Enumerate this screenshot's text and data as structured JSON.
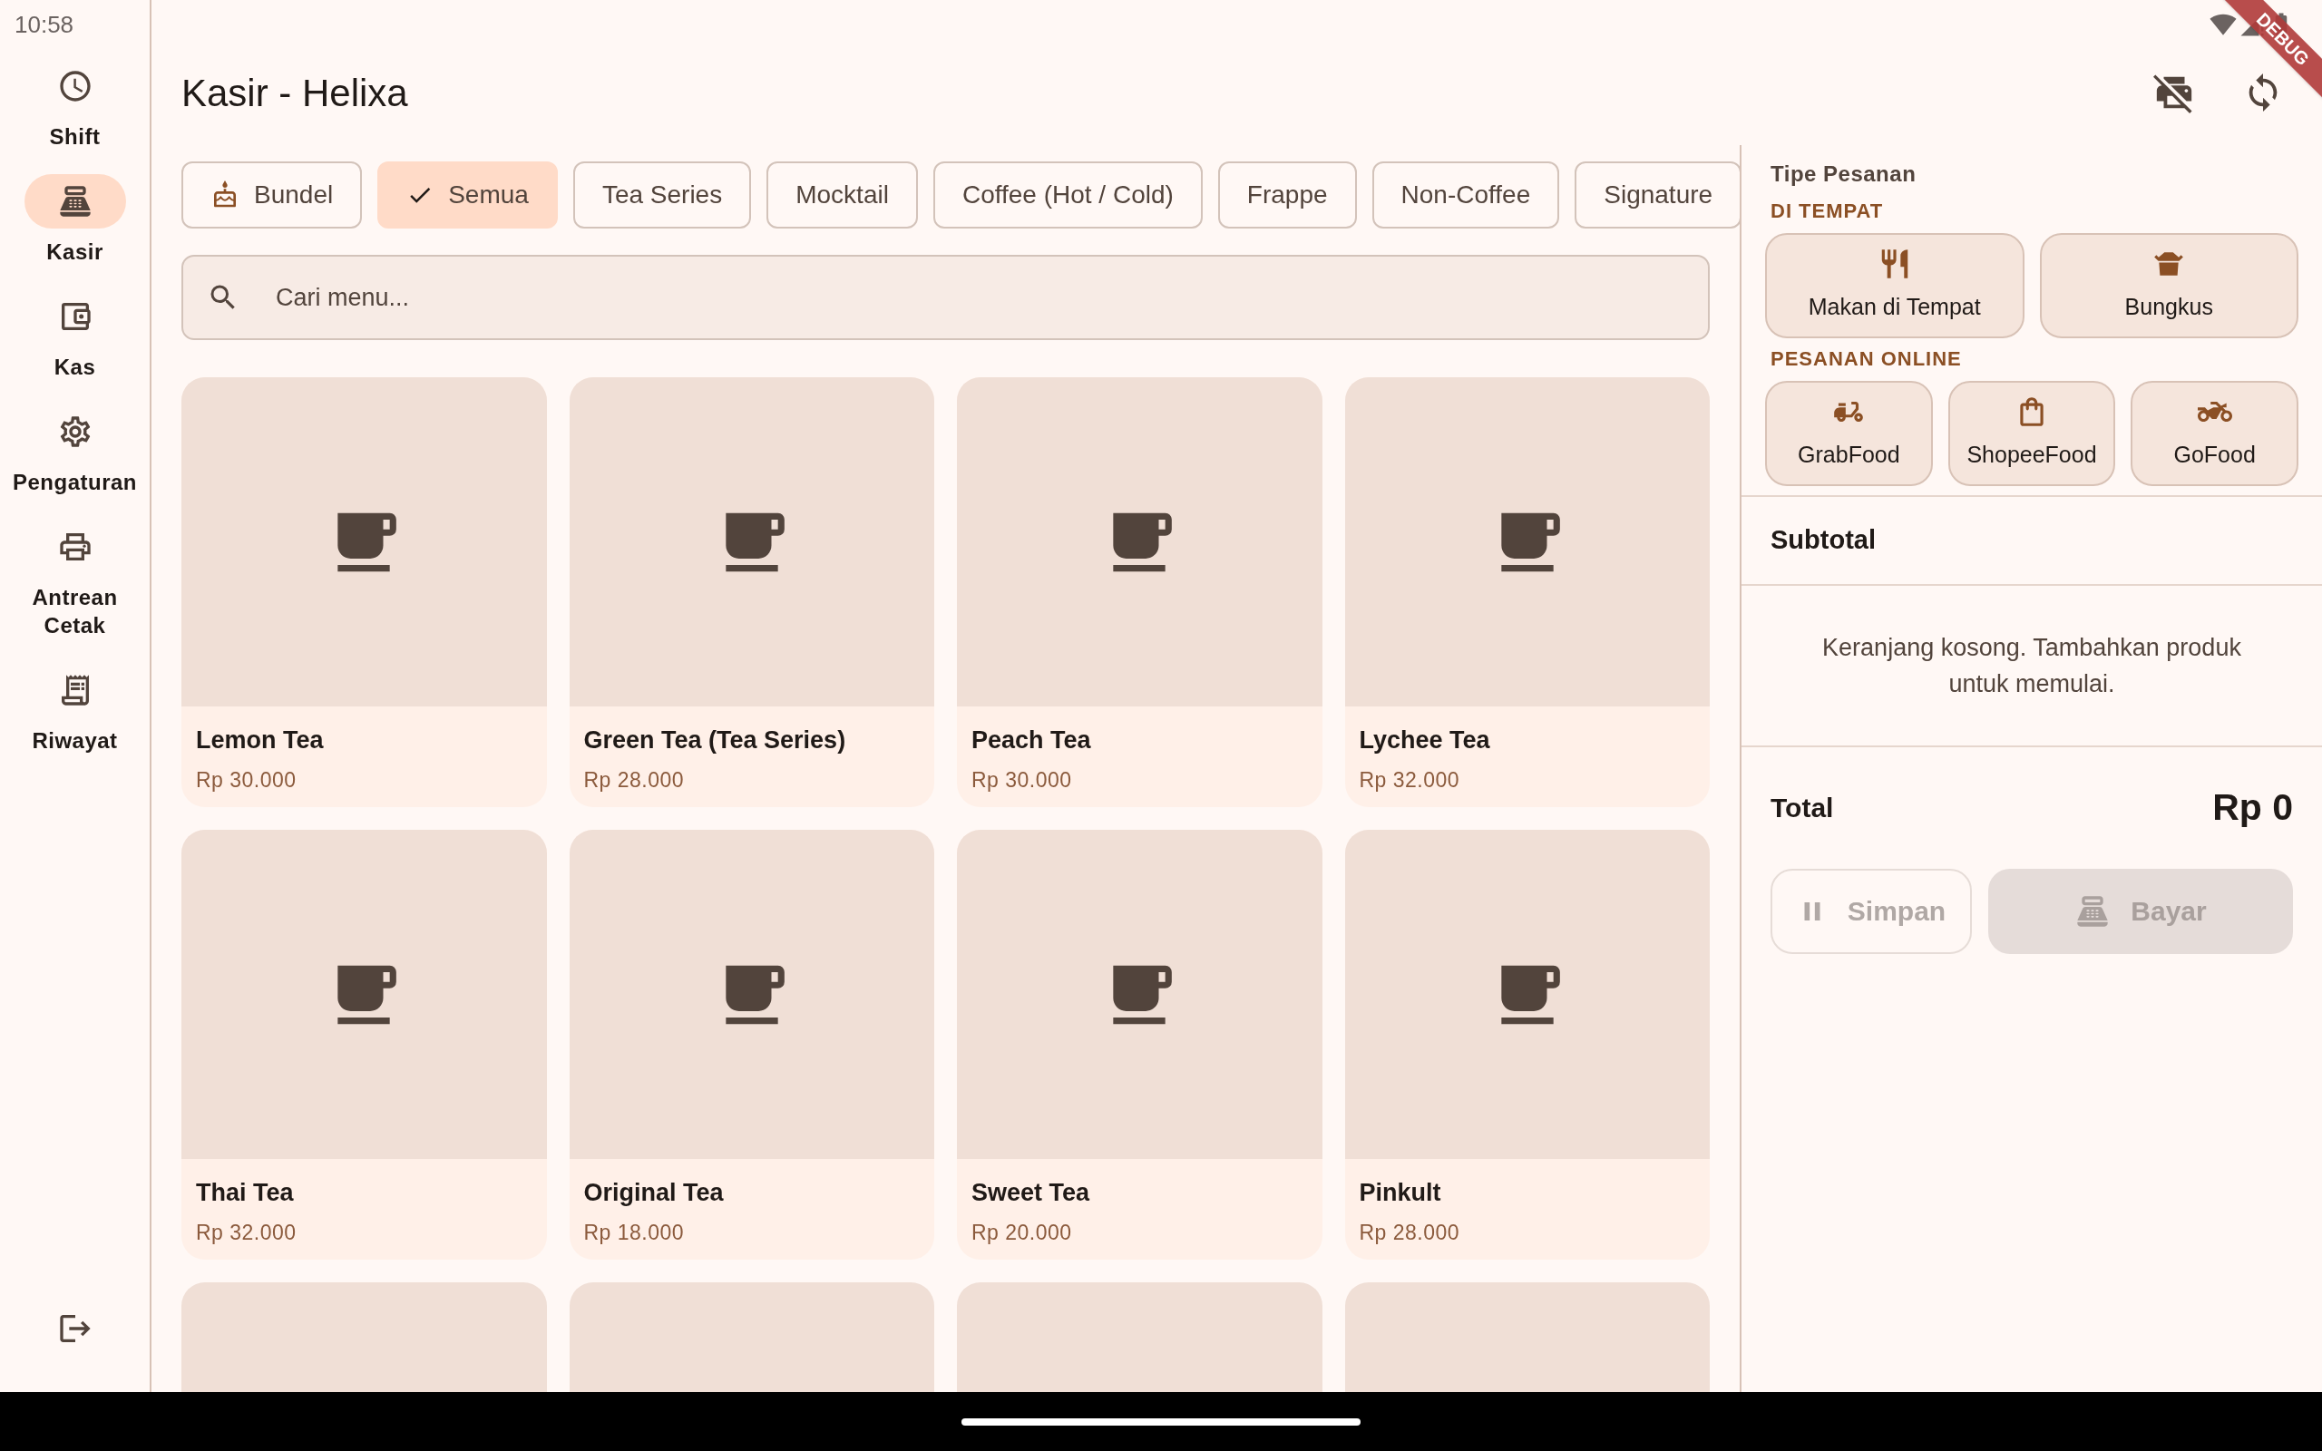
{
  "status_bar": {
    "time": "10:58"
  },
  "debug_banner": "DEBUG",
  "sidebar": {
    "items": [
      {
        "label": "Shift",
        "selected": false
      },
      {
        "label": "Kasir",
        "selected": true
      },
      {
        "label": "Kas",
        "selected": false
      },
      {
        "label": "Pengaturan",
        "selected": false
      },
      {
        "label": "Antrean\nCetak",
        "selected": false
      },
      {
        "label": "Riwayat",
        "selected": false
      }
    ]
  },
  "header": {
    "title": "Kasir - Helixa"
  },
  "categories": [
    {
      "label": "Bundel",
      "kind": "bundle",
      "selected": false
    },
    {
      "label": "Semua",
      "kind": "filter",
      "selected": true
    },
    {
      "label": "Tea Series",
      "kind": "filter",
      "selected": false
    },
    {
      "label": "Mocktail",
      "kind": "filter",
      "selected": false
    },
    {
      "label": "Coffee (Hot / Cold)",
      "kind": "filter",
      "selected": false
    },
    {
      "label": "Frappe",
      "kind": "filter",
      "selected": false
    },
    {
      "label": "Non-Coffee",
      "kind": "filter",
      "selected": false
    },
    {
      "label": "Signature",
      "kind": "filter",
      "selected": false
    }
  ],
  "search": {
    "placeholder": "Cari menu..."
  },
  "products": [
    {
      "kind": "full",
      "name": "Lemon Tea",
      "price": "Rp 30.000"
    },
    {
      "kind": "full",
      "name": "Green Tea (Tea Series)",
      "price": "Rp 28.000"
    },
    {
      "kind": "full",
      "name": "Peach Tea",
      "price": "Rp 30.000"
    },
    {
      "kind": "full",
      "name": "Lychee Tea",
      "price": "Rp 32.000"
    },
    {
      "kind": "full",
      "name": "Thai Tea",
      "price": "Rp 32.000"
    },
    {
      "kind": "full",
      "name": "Original Tea",
      "price": "Rp 18.000"
    },
    {
      "kind": "full",
      "name": "Sweet Tea",
      "price": "Rp 20.000"
    },
    {
      "kind": "full",
      "name": "Pinkult",
      "price": "Rp 28.000"
    },
    {
      "kind": "partial"
    },
    {
      "kind": "partial"
    },
    {
      "kind": "partial"
    },
    {
      "kind": "partial"
    }
  ],
  "order_panel": {
    "title": "Tipe Pesanan",
    "groups": [
      {
        "heading": "DI TEMPAT",
        "options": [
          {
            "label": "Makan di Tempat"
          },
          {
            "label": "Bungkus"
          }
        ]
      },
      {
        "heading": "PESANAN ONLINE",
        "options": [
          {
            "label": "GrabFood"
          },
          {
            "label": "ShopeeFood"
          },
          {
            "label": "GoFood"
          }
        ]
      }
    ]
  },
  "cart": {
    "subtotal_label": "Subtotal",
    "empty_message": "Keranjang kosong. Tambahkan produk untuk memulai.",
    "total_label": "Total",
    "total": "Rp 0"
  },
  "actions": [
    {
      "label": "Simpan",
      "kind": "outline",
      "disabled": true
    },
    {
      "label": "Bayar",
      "kind": "filled",
      "disabled": true
    }
  ]
}
